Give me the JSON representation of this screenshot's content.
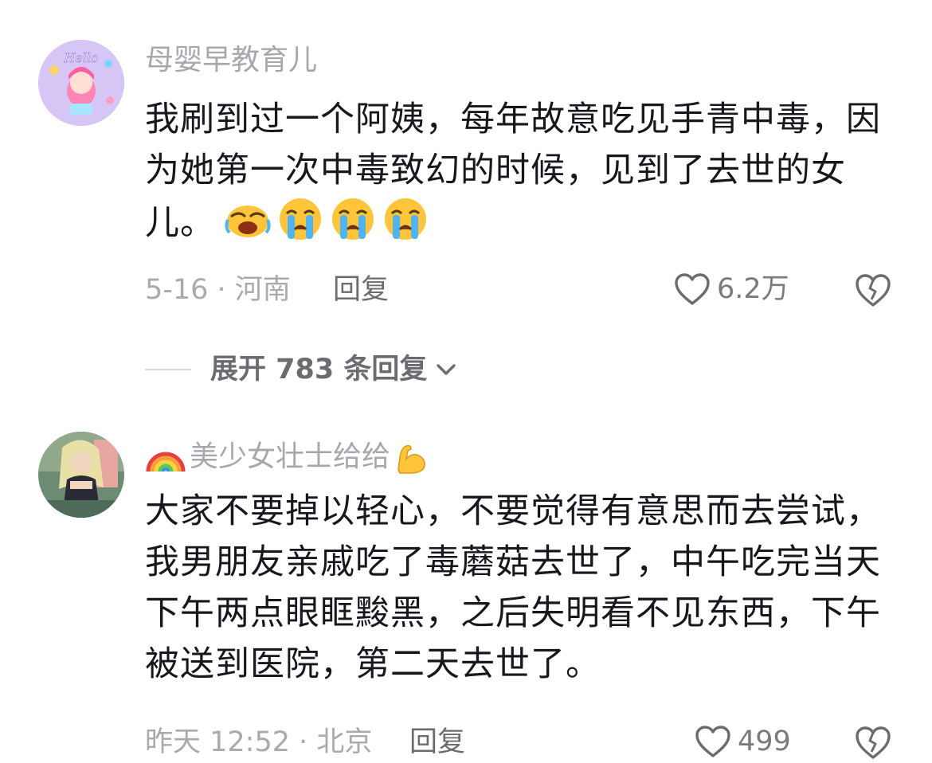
{
  "comments": [
    {
      "username": "母婴早教育儿",
      "avatar_text": "Hello",
      "lines": [
        "我刷到过一个阿姨，每年故意吃见手青中毒，因",
        "为她第一次中毒致幻的时候，见到了去世的女",
        "儿。"
      ],
      "emojis": [
        "loud-crying-emoji",
        "crying-emoji",
        "crying-emoji",
        "crying-emoji"
      ],
      "meta": "5-16 · 河南",
      "reply_label": "回复",
      "likes": "6.2万"
    },
    {
      "username_prefix_icon": "rainbow-emoji",
      "username": "美少女壮士给给",
      "username_suffix_icon": "flexed-biceps-emoji",
      "lines": [
        "大家不要掉以轻心，不要觉得有意思而去尝试，",
        "我男朋友亲戚吃了毒蘑菇去世了，中午吃完当天",
        "下午两点眼眶黢黑，之后失明看不见东西，下午",
        "被送到医院，第二天去世了。"
      ],
      "meta": "昨天 12:52 · 北京",
      "reply_label": "回复",
      "likes": "499"
    }
  ],
  "expand_replies": {
    "label": "展开 783 条回复",
    "icon": "chevron-down-icon"
  },
  "colors": {
    "text": "#17171d",
    "muted": "#a9a9ae",
    "action": "#6b6b70"
  }
}
